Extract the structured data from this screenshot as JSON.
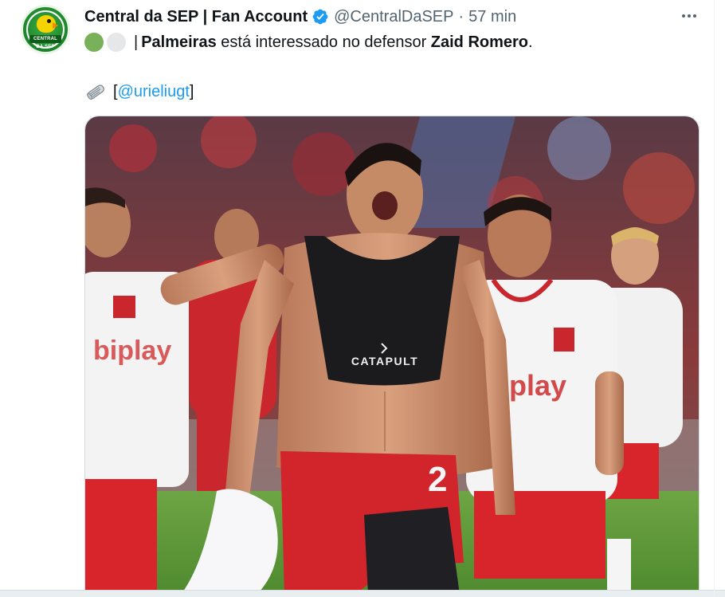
{
  "tweet": {
    "author_name": "Central da SEP | Fan Account",
    "handle": "@CentralDaSEP",
    "separator": "·",
    "time": "57 min",
    "verified": true,
    "avatar_text": "CENTRAL DA SEP",
    "more_icon": "more-horizontal-icon",
    "text": {
      "emoji_1": "green-circle",
      "emoji_2": "white-circle",
      "pipe": "|",
      "club": "Palmeiras",
      "middle": " está interessado no defensor ",
      "player": "Zaid Romero",
      "end": ".",
      "source_icon": "rolled-newspaper-icon",
      "bracket_open": "[",
      "mention": "@urieliugt",
      "bracket_close": "]"
    },
    "media": {
      "jersey_sponsor": "biplay",
      "vest_brand": "CATAPULT",
      "shorts_number": "2",
      "alt_colors": {
        "jersey": "#f4f4f4",
        "shorts": "#d8242b",
        "grass": "#5f9a3a"
      }
    }
  },
  "colors": {
    "accent": "#1d9bf0",
    "text": "#0f1419",
    "secondary": "#536471",
    "verified": "#1d9bf0"
  }
}
